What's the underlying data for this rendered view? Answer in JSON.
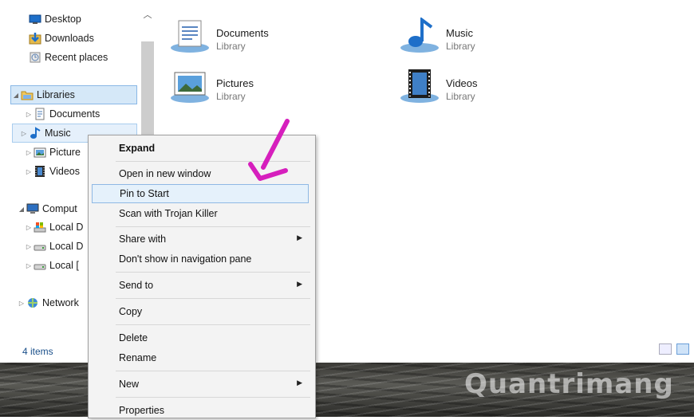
{
  "nav": {
    "items": [
      {
        "label": "Desktop",
        "icon": "desktop-icon"
      },
      {
        "label": "Downloads",
        "icon": "downloads-icon"
      },
      {
        "label": "Recent places",
        "icon": "recent-places-icon"
      },
      {
        "label": "Libraries",
        "icon": "libraries-icon"
      },
      {
        "label": "Documents",
        "icon": "documents-icon"
      },
      {
        "label": "Music",
        "icon": "music-icon"
      },
      {
        "label": "Picture",
        "icon": "pictures-icon"
      },
      {
        "label": "Videos",
        "icon": "videos-icon"
      },
      {
        "label": "Comput",
        "icon": "computer-icon"
      },
      {
        "label": "Local D",
        "icon": "drive-c-icon"
      },
      {
        "label": "Local D",
        "icon": "drive-icon"
      },
      {
        "label": "Local [",
        "icon": "drive-icon"
      },
      {
        "label": "Network",
        "icon": "network-icon"
      }
    ]
  },
  "content": {
    "tiles": [
      {
        "name": "Documents",
        "type": "Library"
      },
      {
        "name": "Music",
        "type": "Library"
      },
      {
        "name": "Pictures",
        "type": "Library"
      },
      {
        "name": "Videos",
        "type": "Library"
      }
    ]
  },
  "status": {
    "items_count": "4 items"
  },
  "context_menu": {
    "items": [
      {
        "label": "Expand"
      },
      {
        "label": "Open in new window"
      },
      {
        "label": "Pin to Start"
      },
      {
        "label": "Scan with Trojan Killer"
      },
      {
        "label": "Share with"
      },
      {
        "label": "Don't show in navigation pane"
      },
      {
        "label": "Send to"
      },
      {
        "label": "Copy"
      },
      {
        "label": "Delete"
      },
      {
        "label": "Rename"
      },
      {
        "label": "New"
      },
      {
        "label": "Properties"
      }
    ]
  },
  "watermark": "Quantrimang",
  "colors": {
    "accent": "#d61fbd",
    "selection": "#d5e8f8",
    "menu_bg": "#f3f3f3"
  }
}
